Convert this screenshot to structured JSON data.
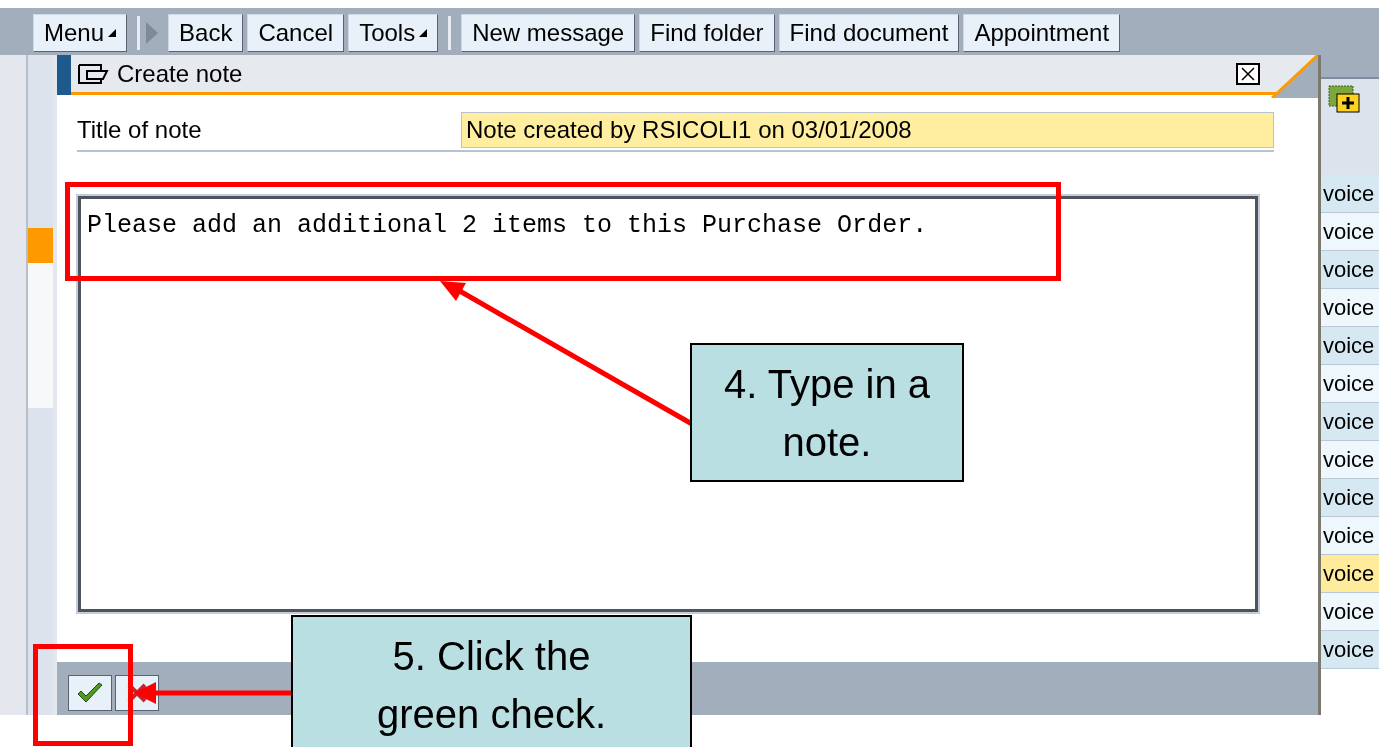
{
  "toolbar": {
    "buttons": [
      {
        "label": "Menu",
        "kind": "dropdown"
      },
      {
        "kind": "separator"
      },
      {
        "label": "Back",
        "kind": "plain"
      },
      {
        "label": "Cancel",
        "kind": "plain"
      },
      {
        "label": "Tools",
        "kind": "dropdown"
      },
      {
        "kind": "separator"
      },
      {
        "label": "New message",
        "kind": "plain"
      },
      {
        "label": "Find folder",
        "kind": "plain"
      },
      {
        "label": "Find document",
        "kind": "plain"
      },
      {
        "label": "Appointment",
        "kind": "plain"
      }
    ]
  },
  "dialog": {
    "title": "Create note",
    "field": {
      "label": "Title of note",
      "value": "Note created by RSICOLI1 on 03/01/2008"
    },
    "note_text": "Please add an additional 2 items to this Purchase Order."
  },
  "table": {
    "rows": [
      {
        "text": "voice",
        "selected": false
      },
      {
        "text": "voice",
        "selected": false
      },
      {
        "text": "voice",
        "selected": false
      },
      {
        "text": "voice",
        "selected": false
      },
      {
        "text": "voice",
        "selected": false
      },
      {
        "text": "voice",
        "selected": false
      },
      {
        "text": "voice",
        "selected": false
      },
      {
        "text": "voice",
        "selected": false
      },
      {
        "text": "voice",
        "selected": false
      },
      {
        "text": "voice",
        "selected": false
      },
      {
        "text": "voice",
        "selected": true
      },
      {
        "text": "voice",
        "selected": false
      },
      {
        "text": "voice",
        "selected": false
      }
    ]
  },
  "annotations": [
    {
      "text": "4. Type in a note."
    },
    {
      "text": "5. Click the green check."
    }
  ]
}
